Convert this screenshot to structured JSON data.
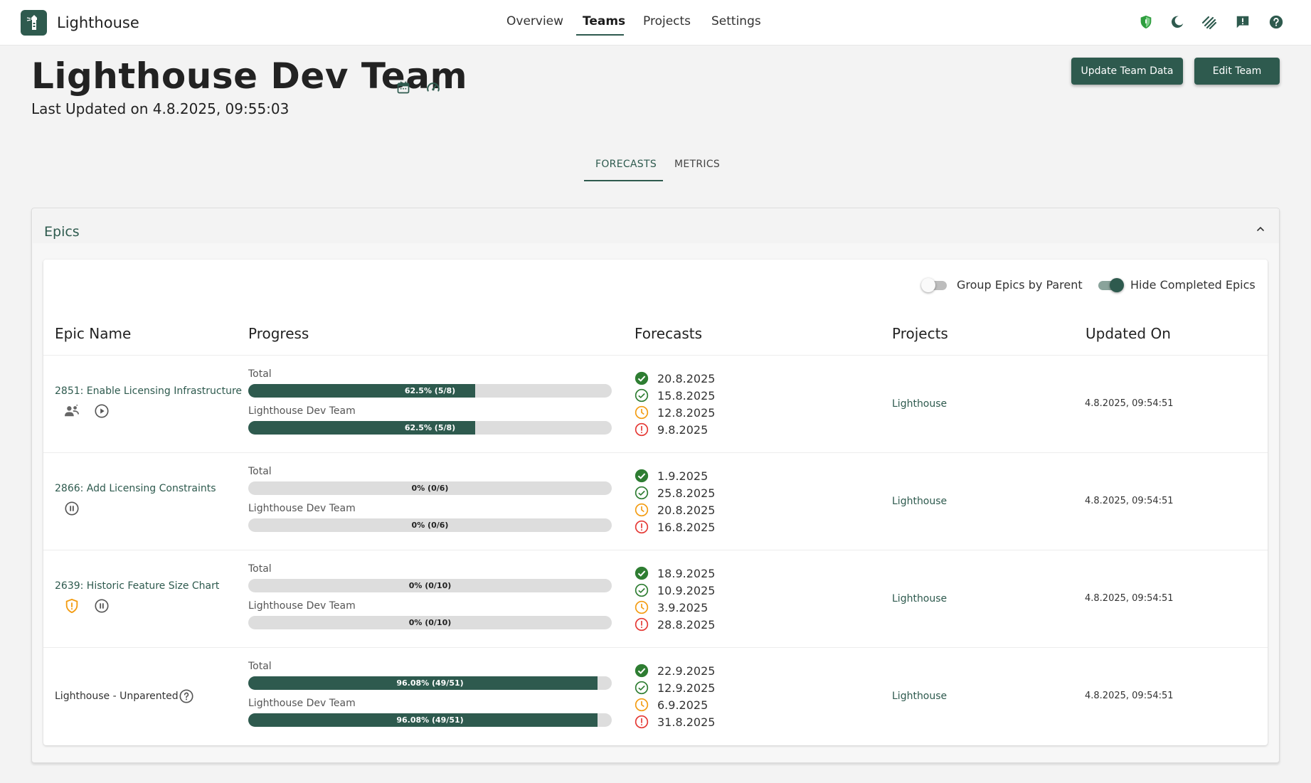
{
  "app": {
    "name": "Lighthouse"
  },
  "nav": {
    "items": [
      {
        "label": "Overview",
        "active": false
      },
      {
        "label": "Teams",
        "active": true
      },
      {
        "label": "Projects",
        "active": false
      },
      {
        "label": "Settings",
        "active": false
      }
    ],
    "icons": [
      "shield-icon",
      "dark-mode-icon",
      "broadcast-icon",
      "feedback-icon",
      "help-icon"
    ]
  },
  "page": {
    "title": "Lighthouse Dev Team",
    "last_updated": "Last Updated on 4.8.2025, 09:55:03",
    "buttons": {
      "update": "Update Team Data",
      "edit": "Edit Team"
    }
  },
  "tabs": [
    {
      "label": "FORECASTS",
      "active": true
    },
    {
      "label": "METRICS",
      "active": false
    }
  ],
  "epics": {
    "title": "Epics",
    "toggles": [
      {
        "label": "Group Epics by Parent",
        "on": false
      },
      {
        "label": "Hide Completed Epics",
        "on": true
      }
    ],
    "columns": [
      "Epic Name",
      "Progress",
      "Forecasts",
      "Projects",
      "Updated On"
    ],
    "progress_labels": {
      "total": "Total",
      "team": "Lighthouse Dev Team"
    },
    "rows": [
      {
        "name": "2851: Enable Licensing Infrastructure",
        "is_link": true,
        "icons": [
          "team-icon",
          "play-icon"
        ],
        "total": {
          "fraction": 0.625,
          "label": "62.5% (5/8)"
        },
        "team": {
          "fraction": 0.625,
          "label": "62.5% (5/8)"
        },
        "forecasts": [
          "20.8.2025",
          "15.8.2025",
          "12.8.2025",
          "9.8.2025"
        ],
        "project": "Lighthouse",
        "updated": "4.8.2025, 09:54:51"
      },
      {
        "name": "2866: Add Licensing Constraints",
        "is_link": true,
        "icons": [
          "pause-icon"
        ],
        "total": {
          "fraction": 0,
          "label": "0% (0/6)"
        },
        "team": {
          "fraction": 0,
          "label": "0% (0/6)"
        },
        "forecasts": [
          "1.9.2025",
          "25.8.2025",
          "20.8.2025",
          "16.8.2025"
        ],
        "project": "Lighthouse",
        "updated": "4.8.2025, 09:54:51"
      },
      {
        "name": "2639: Historic Feature Size Chart",
        "is_link": true,
        "icons": [
          "warning-shield-icon",
          "pause-icon"
        ],
        "total": {
          "fraction": 0,
          "label": "0% (0/10)"
        },
        "team": {
          "fraction": 0,
          "label": "0% (0/10)"
        },
        "forecasts": [
          "18.9.2025",
          "10.9.2025",
          "3.9.2025",
          "28.8.2025"
        ],
        "project": "Lighthouse",
        "updated": "4.8.2025, 09:54:51"
      },
      {
        "name": "Lighthouse - Unparented",
        "is_link": false,
        "icons": [
          "help-circle-icon"
        ],
        "total": {
          "fraction": 0.9608,
          "label": "96.08% (49/51)"
        },
        "team": {
          "fraction": 0.9608,
          "label": "96.08% (49/51)"
        },
        "forecasts": [
          "22.9.2025",
          "12.9.2025",
          "6.9.2025",
          "31.8.2025"
        ],
        "project": "Lighthouse",
        "updated": "4.8.2025, 09:54:51"
      }
    ],
    "forecast_icons": [
      "check-circle-filled-icon",
      "check-circle-outline-icon",
      "clock-icon",
      "error-circle-icon"
    ]
  },
  "colors": {
    "primary": "#2e5a4e",
    "success": "#2e7d32",
    "warning": "#f39c12",
    "danger": "#e53935"
  }
}
